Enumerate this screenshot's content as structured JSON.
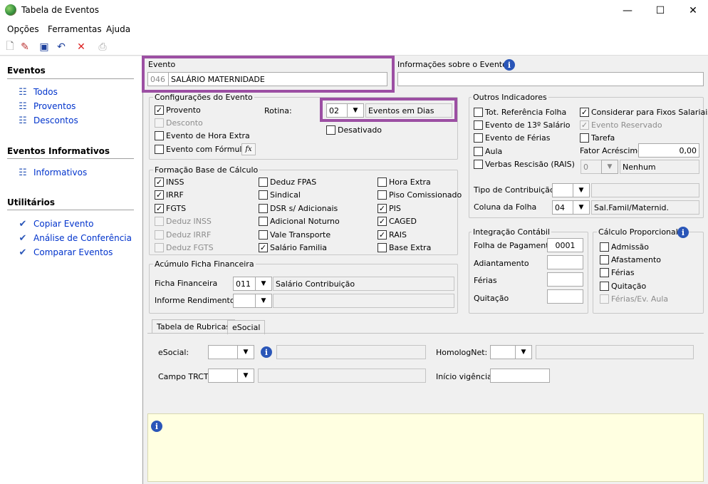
{
  "window": {
    "title": "Tabela de Eventos",
    "minimize": "—",
    "maximize": "☐",
    "close": "✕"
  },
  "menu": [
    "Opções",
    "Ferramentas",
    "Ajuda"
  ],
  "sidebar": {
    "sections": [
      {
        "title": "Eventos",
        "items": [
          "Todos",
          "Proventos",
          "Descontos"
        ]
      },
      {
        "title": "Eventos Informativos",
        "items": [
          "Informativos"
        ]
      },
      {
        "title": "Utilitários",
        "items": [
          "Copiar Evento",
          "Análise de Conferência",
          "Comparar Eventos"
        ]
      }
    ]
  },
  "evento": {
    "label": "Evento",
    "code": "046",
    "name": "SALÁRIO MATERNIDADE"
  },
  "info_evento": {
    "label": "Informações sobre o Evento",
    "value": ""
  },
  "config": {
    "title": "Configurações do Evento",
    "provento": "Provento",
    "desconto": "Desconto",
    "hora_extra": "Evento de Hora Extra",
    "formula": "Evento com Fórmula",
    "fx": "fx",
    "rotina_label": "Rotina:",
    "rotina_code": "02",
    "rotina_desc": "Eventos em Dias",
    "desativado": "Desativado"
  },
  "base": {
    "title": "Formação Base de Cálculo",
    "col1": [
      {
        "label": "INSS",
        "checked": true,
        "disabled": false
      },
      {
        "label": "IRRF",
        "checked": true,
        "disabled": false
      },
      {
        "label": "FGTS",
        "checked": true,
        "disabled": false
      },
      {
        "label": "Deduz INSS",
        "checked": false,
        "disabled": true
      },
      {
        "label": "Deduz IRRF",
        "checked": false,
        "disabled": true
      },
      {
        "label": "Deduz FGTS",
        "checked": false,
        "disabled": true
      }
    ],
    "col2": [
      {
        "label": "Deduz FPAS",
        "checked": false
      },
      {
        "label": "Sindical",
        "checked": false
      },
      {
        "label": "DSR s/ Adicionais",
        "checked": false
      },
      {
        "label": "Adicional Noturno",
        "checked": false
      },
      {
        "label": "Vale Transporte",
        "checked": false
      },
      {
        "label": "Salário Familia",
        "checked": true
      }
    ],
    "col3": [
      {
        "label": "Hora Extra",
        "checked": false
      },
      {
        "label": "Piso Comissionado",
        "checked": false
      },
      {
        "label": "PIS",
        "checked": true
      },
      {
        "label": "CAGED",
        "checked": true
      },
      {
        "label": "RAIS",
        "checked": true
      },
      {
        "label": "Base Extra",
        "checked": false
      }
    ]
  },
  "acumulo": {
    "title": "Acúmulo Ficha Financeira",
    "ficha_label": "Ficha Financeira",
    "ficha_code": "011",
    "ficha_desc": "Salário Contribuição",
    "informe_label": "Informe Rendimentos",
    "informe_code": "",
    "informe_desc": ""
  },
  "outros": {
    "title": "Outros Indicadores",
    "ref_folha": "Tot. Referência Folha",
    "decimo": "Evento de 13º Salário",
    "ferias": "Evento de Férias",
    "aula": "Aula",
    "verbas": "Verbas Rescisão (RAIS)",
    "fixos": "Considerar para Fixos Salariais",
    "reservado": "Evento Reservado",
    "tarefa": "Tarefa",
    "fator_label": "Fator Acréscimo",
    "fator_value": "0,00",
    "verbas_code": "0",
    "verbas_desc": "Nenhum",
    "tipo_label": "Tipo de Contribuição",
    "tipo_code": "",
    "tipo_desc": "",
    "coluna_label": "Coluna da Folha",
    "coluna_code": "04",
    "coluna_desc": "Sal.Famil/Matern​id."
  },
  "integracao": {
    "title": "Integração Contábil",
    "folha_label": "Folha de Pagamento",
    "folha_value": "0001",
    "adiantamento": "Adiantamento",
    "ferias": "Férias",
    "quitacao": "Quitação"
  },
  "proporcional": {
    "title": "Cálculo Proporcional",
    "admissao": "Admissão",
    "afastamento": "Afastamento",
    "ferias": "Férias",
    "quitacao": "Quitação",
    "ferias_aula": "Férias/Ev. Aula"
  },
  "tabs": [
    "Tabela de Rubricas",
    "eSocial"
  ],
  "esocial": {
    "esocial_label": "eSocial:",
    "homolog_label": "HomologNet:",
    "trct_label": "Campo TRCT:",
    "vigencia_label": "Início vigência:"
  }
}
